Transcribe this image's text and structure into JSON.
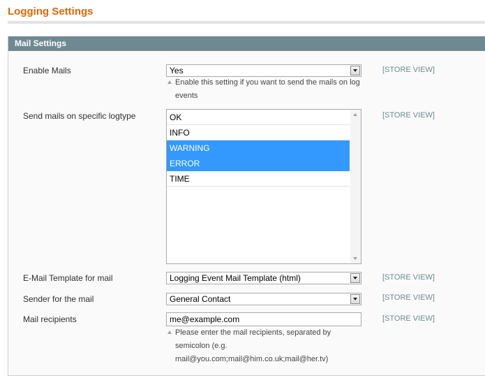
{
  "page": {
    "title": "Logging Settings"
  },
  "fieldset": {
    "title": "Mail Settings"
  },
  "scope_label": "[STORE VIEW]",
  "fields": {
    "enable_mails": {
      "label": "Enable Mails",
      "value": "Yes",
      "note_line1": "Enable this setting if you want to send the mails on log",
      "note_line2": "events"
    },
    "logtype": {
      "label": "Send mails on specific logtype",
      "options": [
        {
          "label": "OK",
          "selected": false
        },
        {
          "label": "INFO",
          "selected": false
        },
        {
          "label": "WARNING",
          "selected": true
        },
        {
          "label": "ERROR",
          "selected": true
        },
        {
          "label": "TIME",
          "selected": false
        }
      ]
    },
    "template": {
      "label": "E-Mail Template for mail",
      "value": "Logging Event Mail Template (html)"
    },
    "sender": {
      "label": "Sender for the mail",
      "value": "General Contact"
    },
    "recipients": {
      "label": "Mail recipients",
      "value": "me@example.com",
      "note_line1": "Please enter the mail recipients, separated by",
      "note_line2": "semicolon (e.g.",
      "note_line3": "mail@you.com;mail@him.co.uk;mail@her.tv)"
    }
  },
  "colors": {
    "title": "#e26703",
    "header_bg": "#6f8992",
    "selection": "#3399ff"
  },
  "icons": {
    "select_arrow": "chevron-down-icon",
    "note_marker": "triangle-up-icon"
  }
}
